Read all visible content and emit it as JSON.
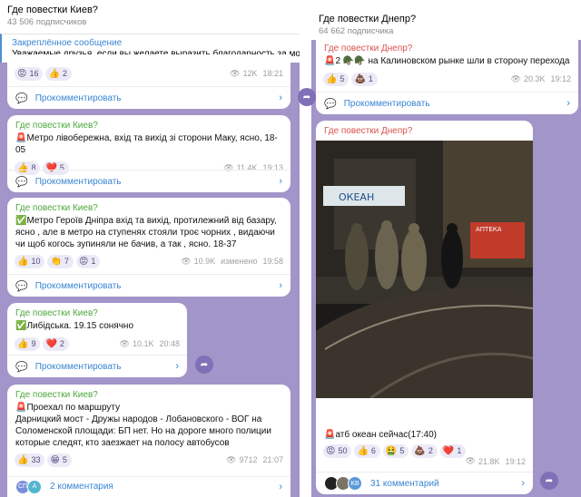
{
  "left": {
    "channel_title": "Где повестки Киев?",
    "subscribers": "43 506 подписчиков",
    "pinned": {
      "label": "Закреплённое сообщение",
      "text": "Уважаемые друзья, если вы желаете выразить благодарность за мою раб"
    },
    "post0": {
      "reactions": [
        {
          "emoji": "😡",
          "count": "16"
        },
        {
          "emoji": "👍",
          "count": "2"
        }
      ],
      "views": "12K",
      "time": "18:21",
      "comment_label": "Прокомментировать"
    },
    "post1": {
      "author": "Где повестки Киев?",
      "text": "🚨Метро лівобережна, вхід та вихід зі сторони Маку, ясно,  18-05",
      "reactions": [
        {
          "emoji": "👍",
          "count": "8"
        },
        {
          "emoji": "❤️",
          "count": "5"
        }
      ],
      "views": "11.4K",
      "time": "19:13",
      "comment_label": "Прокомментировать"
    },
    "post2": {
      "author": "Где повестки Киев?",
      "text": "✅Метро Героїв Дніпра вхід та вихід, протилежний від базару, ясно , але в метро на ступенях стояли троє чорних , видаючи чи щоб когось зупиняли не бачив, а так , ясно. 18-37",
      "reactions": [
        {
          "emoji": "👍",
          "count": "10"
        },
        {
          "emoji": "👏",
          "count": "7"
        },
        {
          "emoji": "😡",
          "count": "1"
        }
      ],
      "views": "10.9K",
      "edited": "изменено",
      "time": "19:58",
      "comment_label": "Прокомментировать"
    },
    "post3": {
      "author": "Где повестки Киев?",
      "text": "✅Либідська. 19.15 сонячно",
      "reactions": [
        {
          "emoji": "👍",
          "count": "9"
        },
        {
          "emoji": "❤️",
          "count": "2"
        }
      ],
      "views": "10.1K",
      "time": "20:48",
      "comment_label": "Прокомментировать"
    },
    "post4": {
      "author": "Где повестки Киев?",
      "text": "🚨Проехал по маршруту\nДарницкий мост - Дружы народов - Лобановского - ВОГ на Соломенской площади: БП нет. Но на дороге много полиции которые следят, кто заезжает на полосу автобусов",
      "reactions": [
        {
          "emoji": "👍",
          "count": "33"
        },
        {
          "emoji": "😁",
          "count": "5"
        }
      ],
      "views": "9712",
      "time": "21:07",
      "comment_avatars": [
        "СП",
        "А"
      ],
      "comment_label": "2 комментария"
    }
  },
  "right": {
    "channel_title": "Где повестки Днепр?",
    "subscribers": "64 662 подписчика",
    "post1": {
      "author": "Где повестки Днепр?",
      "text": "🚨2 🪖🪖 на Калиновском рынке шли в сторону перехода",
      "reactions": [
        {
          "emoji": "👍",
          "count": "5"
        },
        {
          "emoji": "💩",
          "count": "1"
        }
      ],
      "views": "20.3K",
      "time": "19:12",
      "comment_label": "Прокомментировать"
    },
    "post2": {
      "author": "Где повестки Днепр?",
      "photo_sign": "ОКЕАН",
      "photo_sign2": "АПТЕКА",
      "text": "🚨атб океан сейчас(17:40)",
      "reactions": [
        {
          "emoji": "😡",
          "count": "50"
        },
        {
          "emoji": "👍",
          "count": "6"
        },
        {
          "emoji": "🤮",
          "count": "5"
        },
        {
          "emoji": "💩",
          "count": "2"
        },
        {
          "emoji": "❤️",
          "count": "1"
        }
      ],
      "views": "21.8K",
      "time": "19:12",
      "comment_avatars": [
        "",
        "",
        "KB"
      ],
      "comment_label": "31 комментарий"
    }
  },
  "colors": {
    "background": "#a295c9",
    "link": "#3a86d3",
    "author_green": "#4fa83d",
    "author_red": "#d9534f"
  }
}
